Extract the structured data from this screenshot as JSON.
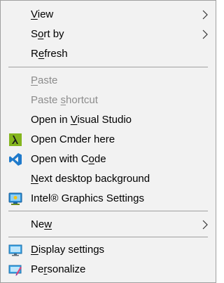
{
  "menu": {
    "items": [
      {
        "id": "view",
        "pre": "",
        "key": "V",
        "post": "iew",
        "has_submenu": true,
        "disabled": false
      },
      {
        "id": "sort-by",
        "pre": "S",
        "key": "o",
        "post": "rt by",
        "has_submenu": true,
        "disabled": false
      },
      {
        "id": "refresh",
        "pre": "R",
        "key": "e",
        "post": "fresh",
        "has_submenu": false,
        "disabled": false
      },
      {
        "id": "paste",
        "pre": "",
        "key": "P",
        "post": "aste",
        "has_submenu": false,
        "disabled": true
      },
      {
        "id": "paste-shortcut",
        "pre": "Paste ",
        "key": "s",
        "post": "hortcut",
        "has_submenu": false,
        "disabled": true
      },
      {
        "id": "open-in-visual-studio",
        "pre": "Open in ",
        "key": "V",
        "post": "isual Studio",
        "has_submenu": false,
        "disabled": false
      },
      {
        "id": "open-cmder-here",
        "pre": "Open Cmder here",
        "key": "",
        "post": "",
        "has_submenu": false,
        "disabled": false,
        "icon": "cmder-lambda-icon"
      },
      {
        "id": "open-with-code",
        "pre": "Open with C",
        "key": "o",
        "post": "de",
        "has_submenu": false,
        "disabled": false,
        "icon": "vscode-icon"
      },
      {
        "id": "next-desktop-background",
        "pre": "",
        "key": "N",
        "post": "ext desktop background",
        "has_submenu": false,
        "disabled": false
      },
      {
        "id": "intel-graphics-settings",
        "pre": "Intel® Graphics Settings",
        "key": "",
        "post": "",
        "has_submenu": false,
        "disabled": false,
        "icon": "intel-graphics-icon"
      },
      {
        "id": "new",
        "pre": "Ne",
        "key": "w",
        "post": "",
        "has_submenu": true,
        "disabled": false
      },
      {
        "id": "display-settings",
        "pre": "",
        "key": "D",
        "post": "isplay settings",
        "has_submenu": false,
        "disabled": false,
        "icon": "display-icon"
      },
      {
        "id": "personalize",
        "pre": "Pe",
        "key": "r",
        "post": "sonalize",
        "has_submenu": false,
        "disabled": false,
        "icon": "personalize-icon"
      }
    ]
  },
  "colors": {
    "menu_background": "#f2f2f2",
    "border": "#a0a0a0",
    "text": "#000000",
    "disabled_text": "#8c8c8c",
    "cmder_green": "#84b51d",
    "vscode_blue": "#1f7acb",
    "intel_blue": "#2a8fd6"
  }
}
